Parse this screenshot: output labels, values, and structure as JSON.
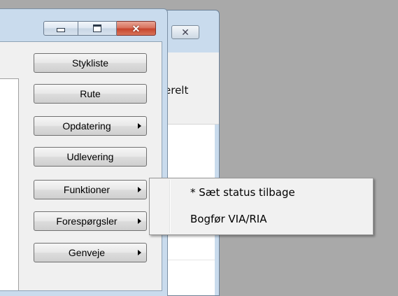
{
  "back_window": {
    "close_glyph": "✕",
    "partial_label": "erelt"
  },
  "front_window": {
    "caption": {
      "minimize": "minimize",
      "maximize": "maximize",
      "close": "✕"
    },
    "buttons": [
      {
        "label": "Stykliste",
        "has_submenu": false
      },
      {
        "label": "Rute",
        "has_submenu": false
      },
      {
        "label": "Opdatering",
        "has_submenu": true
      },
      {
        "label": "Udlevering",
        "has_submenu": false
      },
      {
        "label": "Funktioner",
        "has_submenu": true
      },
      {
        "label": "Forespørgsler",
        "has_submenu": true
      },
      {
        "label": "Genveje",
        "has_submenu": true
      }
    ]
  },
  "popup_menu": {
    "items": [
      {
        "label": "* Sæt status tilbage"
      },
      {
        "label": "Bogfør VIA/RIA"
      }
    ]
  },
  "colors": {
    "desktop": "#a9a9a9",
    "window_frame": "#c9dbed",
    "close_red": "#c7452d"
  }
}
